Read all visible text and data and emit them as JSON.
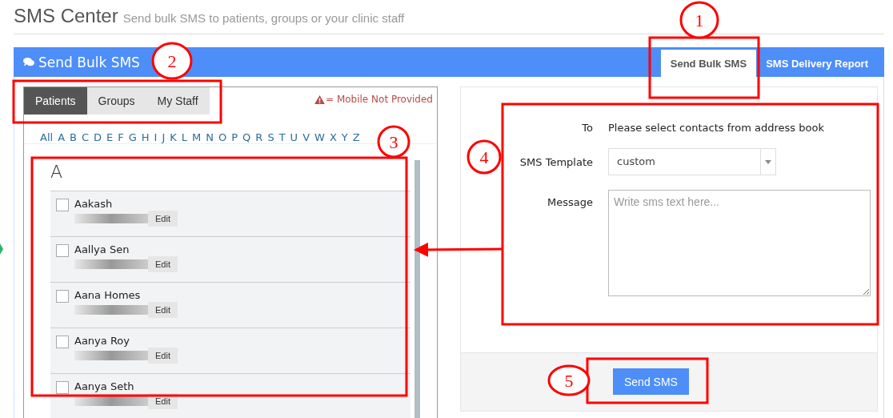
{
  "header": {
    "title": "SMS Center",
    "subtitle": "Send bulk SMS to patients, groups or your clinic staff"
  },
  "bar": {
    "title": "Send Bulk SMS",
    "tabs": [
      {
        "label": "Send Bulk SMS",
        "selected": true
      },
      {
        "label": "SMS Delivery Report",
        "selected": false
      }
    ]
  },
  "contacts": {
    "tabs": [
      {
        "label": "Patients",
        "selected": true
      },
      {
        "label": "Groups",
        "selected": false
      },
      {
        "label": "My Staff",
        "selected": false
      }
    ],
    "legend": "= Mobile Not Provided",
    "letters": [
      "All",
      "A",
      "B",
      "C",
      "D",
      "E",
      "F",
      "G",
      "H",
      "I",
      "J",
      "K",
      "L",
      "M",
      "N",
      "O",
      "P",
      "Q",
      "R",
      "S",
      "T",
      "U",
      "V",
      "W",
      "X",
      "Y",
      "Z"
    ],
    "section": "A",
    "rows": [
      {
        "name": "Aakash",
        "checked": false,
        "action": "Edit"
      },
      {
        "name": "Aallya Sen",
        "checked": false,
        "action": "Edit"
      },
      {
        "name": "Aana Homes",
        "checked": false,
        "action": "Edit"
      },
      {
        "name": "Aanya Roy",
        "checked": false,
        "action": "Edit"
      },
      {
        "name": "Aanya Seth",
        "checked": false,
        "action": "Edit"
      }
    ]
  },
  "form": {
    "to_label": "To",
    "to_value": "Please select contacts from address book",
    "template_label": "SMS Template",
    "template_value": "custom",
    "message_label": "Message",
    "message_placeholder": "Write sms text here...",
    "send": "Send SMS"
  },
  "annotations": [
    {
      "label": "1"
    },
    {
      "label": "2"
    },
    {
      "label": "3"
    },
    {
      "label": "4"
    },
    {
      "label": "5"
    }
  ]
}
